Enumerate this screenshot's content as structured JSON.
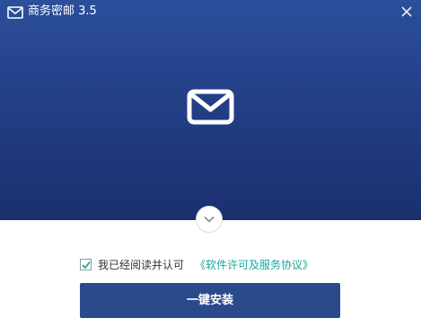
{
  "titlebar": {
    "title": "商务密邮 3.5",
    "app_icon": "mail-icon",
    "close_icon": "close-icon"
  },
  "hero": {
    "logo_icon": "mail-icon",
    "expand_icon": "chevron-down-icon"
  },
  "agreement": {
    "checked": true,
    "text": "我已经阅读并认可",
    "link_text": "《软件许可及服务协议》"
  },
  "install": {
    "label": "一键安装"
  },
  "colors": {
    "hero_top": "#2c4f9c",
    "hero_bottom": "#1b2f6e",
    "button": "#2b4a8c",
    "link": "#17a89a",
    "checkmark": "#17a89a"
  }
}
